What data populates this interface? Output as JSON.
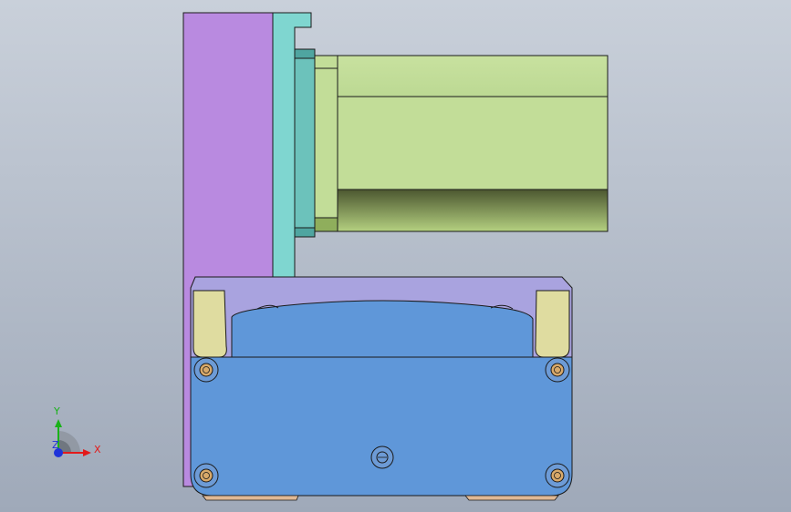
{
  "viewport": {
    "background_top": "#c9d0da",
    "background_bottom": "#9fa9b9"
  },
  "colors": {
    "outline": "#1a1a1a",
    "purple_plate": "#b98ae0",
    "cyan_plate": "#7fd6d0",
    "cyan_dark": "#4fa5a0",
    "green_body": "#c2dd98",
    "green_dark": "#5e6a3c",
    "green_shade": "#8fae5c",
    "lavender_top": "#a9a3df",
    "blue_body": "#5f97d9",
    "cream_clip": "#dfdca0",
    "screw_ring": "#6d9bd6",
    "screw_head": "#d8a96a",
    "tan_base": "#e0b995",
    "axis_x": "#e31a1a",
    "axis_y": "#19b219",
    "axis_z": "#1f33d9"
  },
  "triad": {
    "x_label": "X",
    "y_label": "Y",
    "z_label": "Z"
  }
}
